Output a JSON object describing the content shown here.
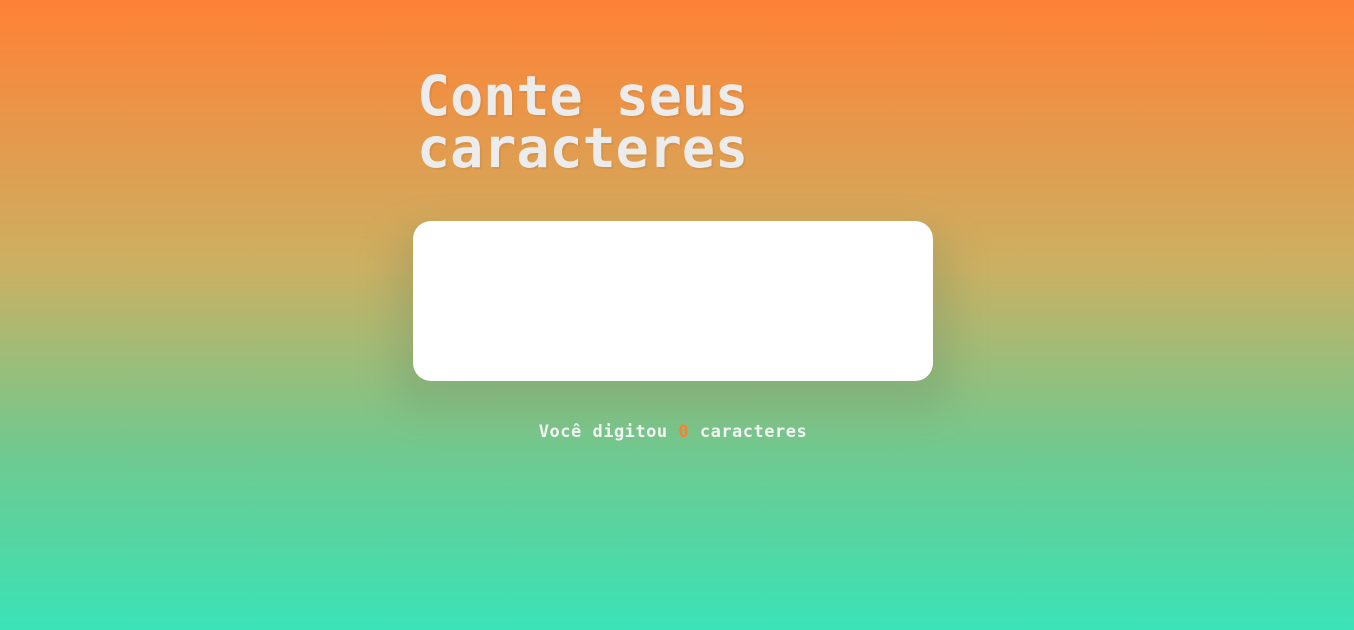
{
  "header": {
    "title_line1": "Conte seus",
    "title_line2": "caracteres"
  },
  "input": {
    "value": "",
    "placeholder": ""
  },
  "counter": {
    "prefix": "Você digitou ",
    "count": "0",
    "suffix": " caracteres",
    "count_color": "#ff7f32"
  },
  "colors": {
    "gradient_top": "#ff8135",
    "gradient_bottom": "#3ae3b7",
    "title": "#ececec"
  }
}
